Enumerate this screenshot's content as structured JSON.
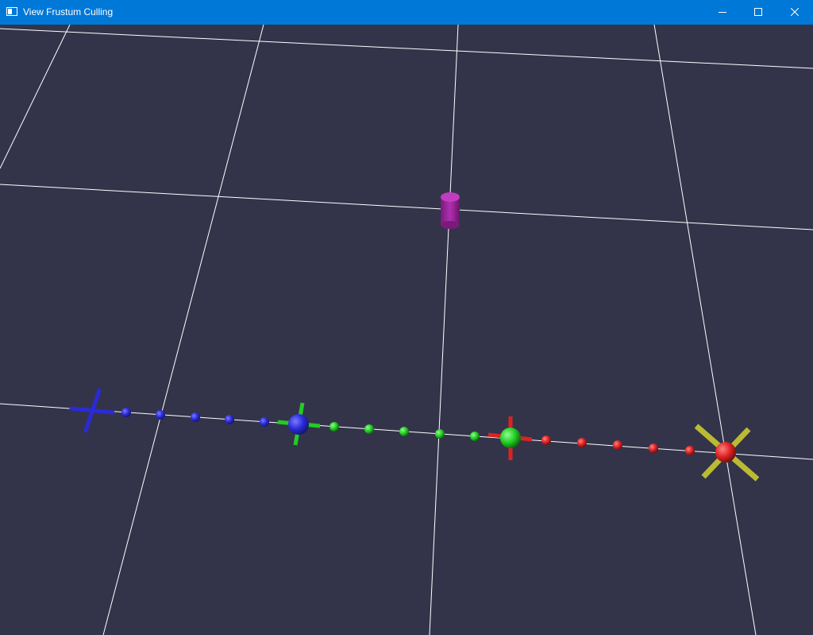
{
  "window": {
    "title": "View Frustum Culling",
    "controls": {
      "minimize": "minimize-icon",
      "maximize": "maximize-icon",
      "close": "close-icon"
    }
  },
  "theme": {
    "titlebar_color": "#0078d7",
    "viewport_background": "#33344a",
    "grid_color": "#ffffff"
  },
  "scene": {
    "objects": [
      {
        "kind": "cylinder",
        "color": "#b030b0"
      },
      {
        "kind": "axis-cross",
        "color": "#2a2ad8"
      },
      {
        "kind": "sphere-marker",
        "color": "#2a2ad8"
      },
      {
        "kind": "sphere-marker",
        "color": "#22cc22"
      },
      {
        "kind": "sphere-marker",
        "color": "#dd2222"
      },
      {
        "kind": "axis-cross",
        "color": "#bbbb33"
      }
    ]
  }
}
